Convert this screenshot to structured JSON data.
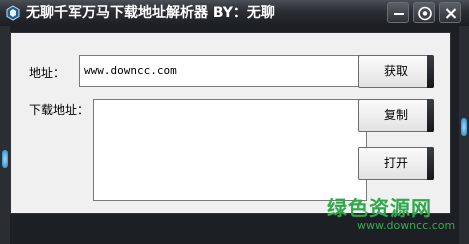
{
  "titlebar": {
    "title": "无聊千军万马下载地址解析器 BY：无聊",
    "icons": [
      "app-icon",
      "minimize-icon",
      "settings-icon",
      "close-icon"
    ]
  },
  "form": {
    "address_label": "地址：",
    "address_value": "www.downcc.com",
    "download_label": "下载地址：",
    "download_value": ""
  },
  "buttons": {
    "fetch": "获取",
    "copy": "复制",
    "open": "打开"
  },
  "watermark": {
    "title": "绿色资源网",
    "url": "www.downcc.com"
  },
  "colors": {
    "frame": "#1c1f24",
    "content_bg": "#f0f0f0",
    "accent_glow": "#2a9fe0",
    "watermark_green": "#2ea84a"
  }
}
